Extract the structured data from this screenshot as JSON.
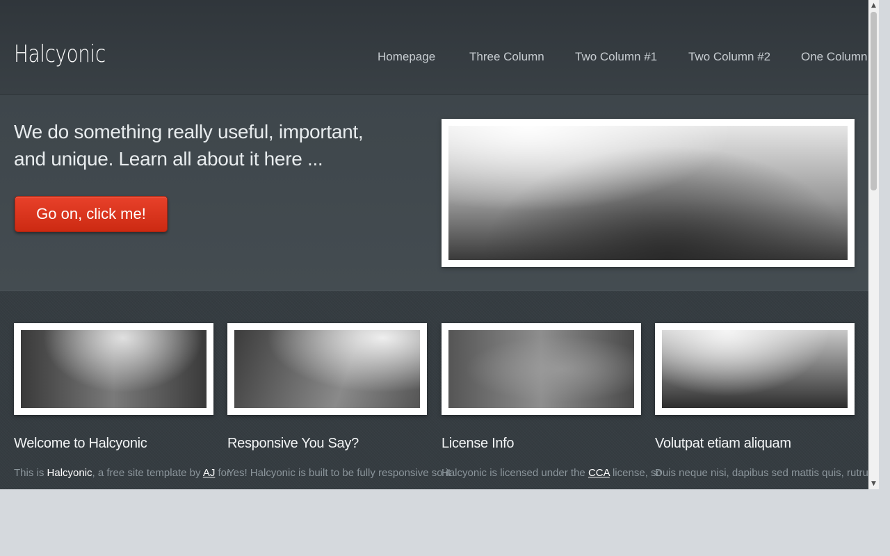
{
  "header": {
    "logo": "Halcyonic",
    "nav": [
      {
        "label": "Homepage"
      },
      {
        "label": "Three Column"
      },
      {
        "label": "Two Column #1"
      },
      {
        "label": "Two Column #2"
      },
      {
        "label": "One Column"
      }
    ]
  },
  "banner": {
    "title": "We do something really useful, important, and unique. Learn all about it here ...",
    "button_label": "Go on, click me!"
  },
  "cards": [
    {
      "title": "Welcome to Halcyonic",
      "text_before": "This is ",
      "text_bold": "Halcyonic",
      "text_mid": ", a free site template by ",
      "text_link": "AJ",
      "text_after": " for"
    },
    {
      "title": "Responsive You Say?",
      "text": "Yes! Halcyonic is built to be fully responsive so it"
    },
    {
      "title": "License Info",
      "text_before": "Halcyonic is licensed under the ",
      "text_link": "CCA",
      "text_after": " license, so"
    },
    {
      "title": "Volutpat etiam aliquam",
      "text": "Duis neque nisi, dapibus sed mattis quis, rutrum"
    }
  ],
  "scrollbar": {
    "up_icon": "▲",
    "down_icon": "▼"
  }
}
